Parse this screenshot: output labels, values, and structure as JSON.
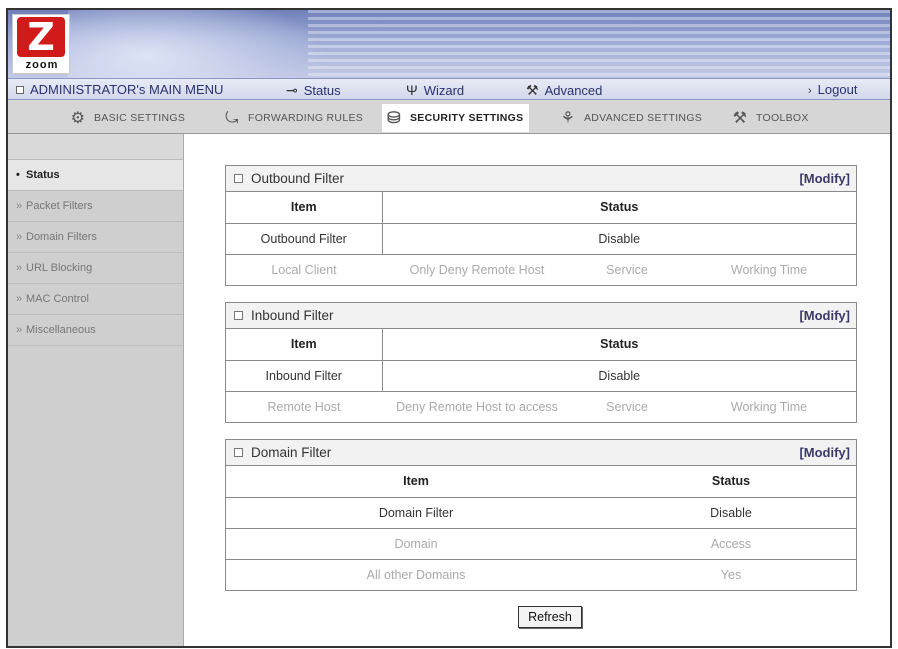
{
  "header": {
    "logo_text": "zoom",
    "logo_glyph": "Z"
  },
  "main_menu": {
    "title": "ADMINISTRATOR's MAIN MENU",
    "status": "Status",
    "wizard": "Wizard",
    "advanced": "Advanced",
    "logout": "Logout",
    "icons": {
      "status": "status-icon",
      "wizard": "wizard-icon",
      "advanced": "advanced-icon",
      "logout": "arrow-right-icon"
    }
  },
  "tabs": [
    {
      "label": "BASIC SETTINGS",
      "icon": "basic-settings-icon"
    },
    {
      "label": "FORWARDING RULES",
      "icon": "forwarding-rules-icon"
    },
    {
      "label": "SECURITY SETTINGS",
      "icon": "security-settings-icon",
      "active": true
    },
    {
      "label": "ADVANCED SETTINGS",
      "icon": "advanced-settings-icon"
    },
    {
      "label": "TOOLBOX",
      "icon": "toolbox-icon"
    }
  ],
  "sidebar": {
    "items": [
      {
        "label": "Status",
        "active": true
      },
      {
        "label": "Packet Filters"
      },
      {
        "label": "Domain Filters"
      },
      {
        "label": "URL Blocking"
      },
      {
        "label": "MAC Control"
      },
      {
        "label": "Miscellaneous"
      }
    ]
  },
  "outbound": {
    "title": "Outbound Filter",
    "modify": "[Modify]",
    "col_item": "Item",
    "col_status": "Status",
    "row_label": "Outbound Filter",
    "row_value": "Disable",
    "sub": [
      "Local Client",
      "Only Deny Remote Host",
      "Service",
      "Working Time"
    ]
  },
  "inbound": {
    "title": "Inbound Filter",
    "modify": "[Modify]",
    "col_item": "Item",
    "col_status": "Status",
    "row_label": "Inbound Filter",
    "row_value": "Disable",
    "sub": [
      "Remote Host",
      "Deny Remote Host to access",
      "Service",
      "Working Time"
    ]
  },
  "domain": {
    "title": "Domain Filter",
    "modify": "[Modify]",
    "col_item": "Item",
    "col_status": "Status",
    "row_label": "Domain Filter",
    "row_value": "Disable",
    "sub_header": [
      "Domain",
      "Access"
    ],
    "sub_row": [
      "All other Domains",
      "Yes"
    ]
  },
  "refresh_label": "Refresh",
  "colors": {
    "banner": "#9aa7d3",
    "menu_text": "#2a3270",
    "logo_red": "#d11a1a",
    "sidebar": "#cfcfcf"
  }
}
